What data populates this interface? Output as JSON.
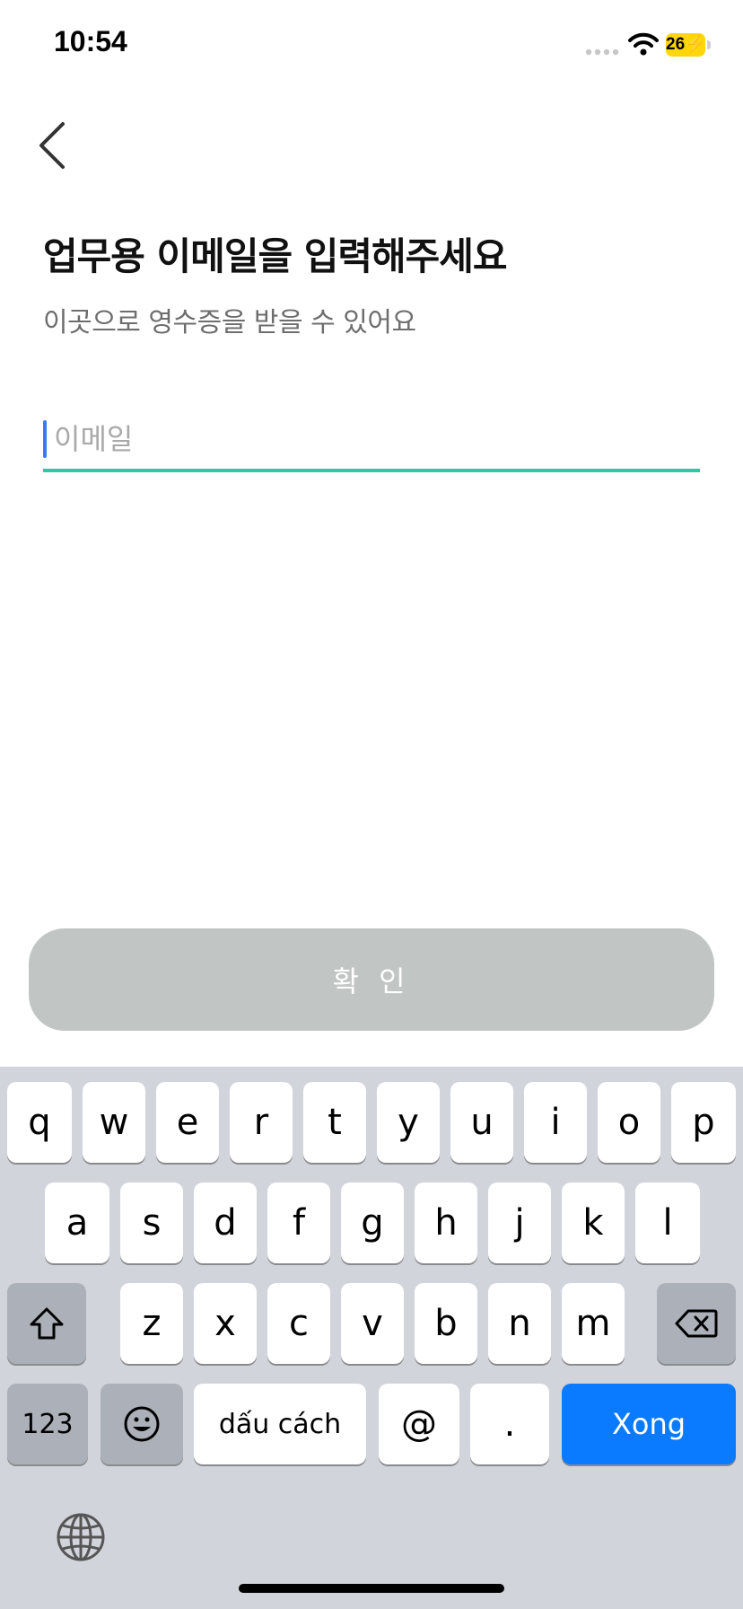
{
  "status_bar": {
    "time": "10:54",
    "battery_level": "26",
    "icons": [
      "signal-icon",
      "wifi-icon",
      "battery-charging-icon"
    ]
  },
  "navigation": {
    "back_icon": "chevron-left-icon"
  },
  "page": {
    "title": "업무용 이메일을 입력해주세요",
    "subtitle": "이곳으로 영수증을 받을 수 있어요"
  },
  "email_input": {
    "placeholder": "이메일",
    "value": ""
  },
  "confirm_button": {
    "label": "확 인"
  },
  "keyboard": {
    "row1": [
      "q",
      "w",
      "e",
      "r",
      "t",
      "y",
      "u",
      "i",
      "o",
      "p"
    ],
    "row2": [
      "a",
      "s",
      "d",
      "f",
      "g",
      "h",
      "j",
      "k",
      "l"
    ],
    "row3": [
      "z",
      "x",
      "c",
      "v",
      "b",
      "n",
      "m"
    ],
    "numbers_label": "123",
    "space_label": "dấu cách",
    "at_label": "@",
    "period_label": ".",
    "done_label": "Xong",
    "icons": [
      "shift-icon",
      "delete-icon",
      "emoji-icon",
      "globe-icon"
    ]
  },
  "colors": {
    "accent_underline": "#2ec7a8",
    "caret": "#3a7bf0",
    "confirm_disabled": "#c1c5c4",
    "keyboard_bg": "#d1d4da",
    "done_key": "#0a7aff",
    "battery": "#ffd60a"
  }
}
